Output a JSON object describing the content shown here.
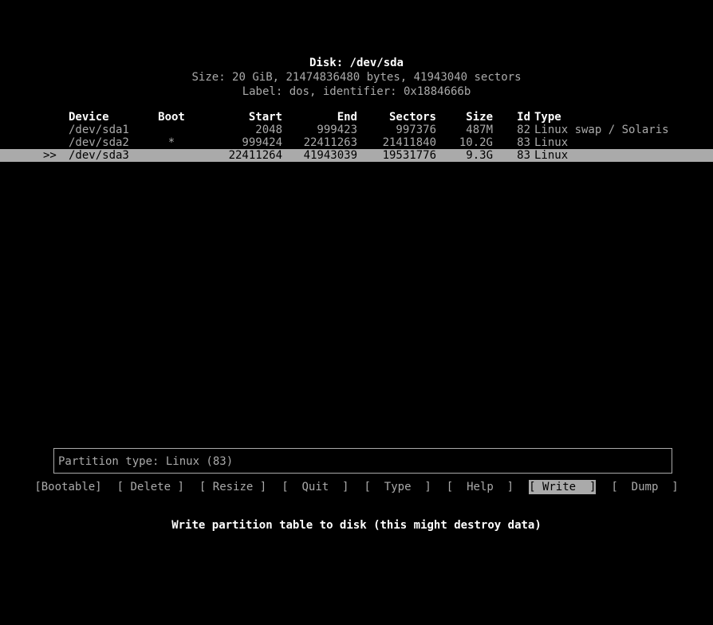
{
  "header": {
    "disk_title": "Disk: /dev/sda",
    "size_line": "Size: 20 GiB, 21474836480 bytes, 41943040 sectors",
    "label_line": "Label: dos, identifier: 0x1884666b"
  },
  "table": {
    "columns": {
      "marker": "",
      "device": "Device",
      "boot": "Boot",
      "start": "Start",
      "end": "End",
      "sectors": "Sectors",
      "size": "Size",
      "id": "Id",
      "type": "Type"
    },
    "rows": [
      {
        "marker": "",
        "device": "/dev/sda1",
        "boot": "",
        "start": "2048",
        "end": "999423",
        "sectors": "997376",
        "size": "487M",
        "id": "82",
        "type": "Linux swap / Solaris",
        "selected": false
      },
      {
        "marker": "",
        "device": "/dev/sda2",
        "boot": "*",
        "start": "999424",
        "end": "22411263",
        "sectors": "21411840",
        "size": "10.2G",
        "id": "83",
        "type": "Linux",
        "selected": false
      },
      {
        "marker": ">>",
        "device": "/dev/sda3",
        "boot": "",
        "start": "22411264",
        "end": "41943039",
        "sectors": "19531776",
        "size": "9.3G",
        "id": "83",
        "type": "Linux",
        "selected": true
      }
    ]
  },
  "info": {
    "partition_type": "Partition type: Linux (83)"
  },
  "menu": {
    "buttons": [
      {
        "label": "[Bootable]",
        "active": false
      },
      {
        "label": "[ Delete ]",
        "active": false
      },
      {
        "label": "[ Resize ]",
        "active": false
      },
      {
        "label": "[  Quit  ]",
        "active": false
      },
      {
        "label": "[  Type  ]",
        "active": false
      },
      {
        "label": "[  Help  ]",
        "active": false
      },
      {
        "label": "[ Write  ]",
        "active": true
      },
      {
        "label": "[  Dump  ]",
        "active": false
      }
    ]
  },
  "hint": {
    "text": "Write partition table to disk (this might destroy data)"
  },
  "colors": {
    "background": "#000000",
    "normal_text": "#aaaaaa",
    "bright_text": "#ffffff",
    "highlight_bg": "#aaaaaa",
    "highlight_fg": "#000000"
  }
}
